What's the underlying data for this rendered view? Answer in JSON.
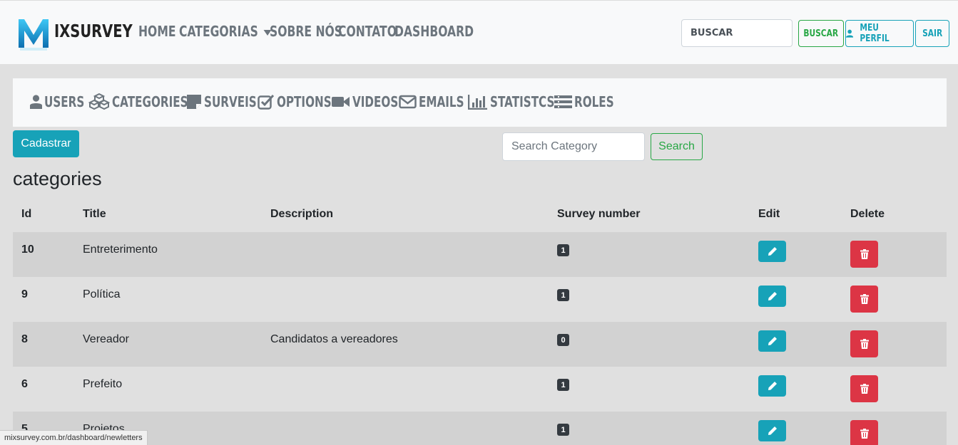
{
  "brand": {
    "name": "IXSURVEY",
    "logo_letter": "M"
  },
  "nav": [
    {
      "label": "HOME"
    },
    {
      "label": "CATEGORIAS"
    },
    {
      "label": "SOBRE NÓS"
    },
    {
      "label": "CONTATO"
    },
    {
      "label": "DASHBOARD"
    }
  ],
  "top_search": {
    "placeholder": "BUSCAR",
    "button": "BUSCAR"
  },
  "profile_button": "MEU PERFIL",
  "logout_button": "SAIR",
  "admin_menu": [
    {
      "label": "USERS",
      "icon": "user-icon"
    },
    {
      "label": "CATEGORIES",
      "icon": "cubes-icon"
    },
    {
      "label": "SURVEIS",
      "icon": "sticky-note-icon"
    },
    {
      "label": "OPTIONS",
      "icon": "check-square-icon"
    },
    {
      "label": "VIDEOS",
      "icon": "video-camera-icon"
    },
    {
      "label": "EMAILS",
      "icon": "envelope-icon"
    },
    {
      "label": "STATISTCS",
      "icon": "bar-chart-icon"
    },
    {
      "label": "ROLES",
      "icon": "list-icon"
    }
  ],
  "cadastrar_button": "Cadastrar",
  "category_search": {
    "placeholder": "Search Category",
    "button": "Search"
  },
  "section_title": "categories",
  "table": {
    "headers": [
      "Id",
      "Title",
      "Description",
      "Survey number",
      "Edit",
      "Delete"
    ],
    "rows": [
      {
        "id": "10",
        "title": "Entreterimento",
        "description": "",
        "surveys": "1"
      },
      {
        "id": "9",
        "title": "Política",
        "description": "",
        "surveys": "1"
      },
      {
        "id": "8",
        "title": "Vereador",
        "description": "Candidatos a vereadores",
        "surveys": "0"
      },
      {
        "id": "6",
        "title": "Prefeito",
        "description": "",
        "surveys": "1"
      },
      {
        "id": "5",
        "title": "Projetos",
        "description": "",
        "surveys": "1"
      }
    ]
  },
  "status_url": "mixsurvey.com.br/dashboard/newletters",
  "colors": {
    "teal": "#17a2b8",
    "green": "#28a745",
    "red": "#dc3545",
    "dark": "#343a40",
    "muted": "#6c757d"
  }
}
